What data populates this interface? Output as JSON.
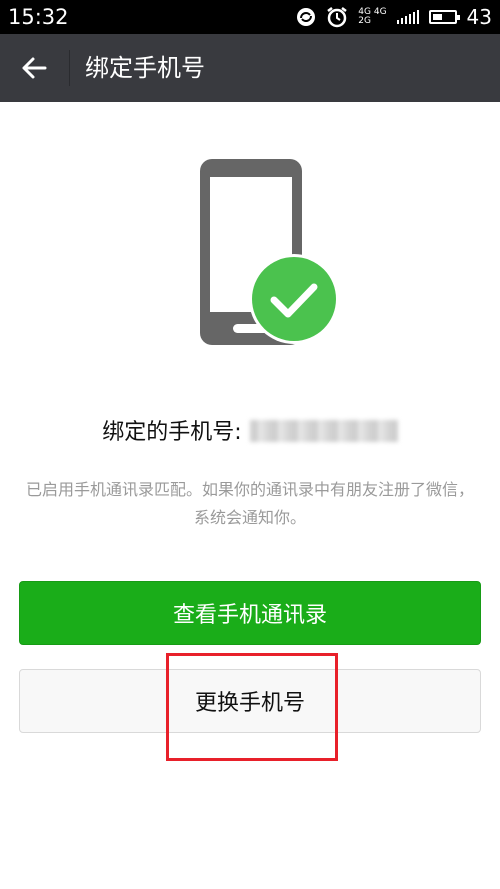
{
  "status_bar": {
    "time": "15:32",
    "network_top": "4G 4G",
    "network_bottom": "2G",
    "battery_percent": "43",
    "battery_level": 0.43
  },
  "title_bar": {
    "back_icon": "arrow-left-icon",
    "title": "绑定手机号"
  },
  "illustration": {
    "phone_icon": "phone-icon",
    "check_icon": "check-circle-icon",
    "phone_color": "#666666",
    "check_color": "#4bc24e"
  },
  "bound_phone": {
    "label": "绑定的手机号:",
    "number_blurred": true
  },
  "description": "已启用手机通讯录匹配。如果你的通讯录中有朋友注册了微信，系统会通知你。",
  "buttons": {
    "view_contacts": "查看手机通讯录",
    "change_number": "更换手机号"
  },
  "colors": {
    "accent_green": "#1aad19",
    "titlebar_bg": "#393a3f",
    "highlight_red": "#e8202a"
  }
}
